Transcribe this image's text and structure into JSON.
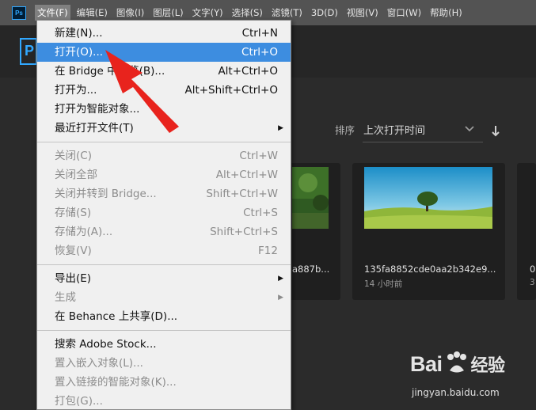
{
  "app": {
    "logo_text": "Ps",
    "home_logo_text": "P"
  },
  "menubar": {
    "items": [
      "文件(F)",
      "编辑(E)",
      "图像(I)",
      "图层(L)",
      "文字(Y)",
      "选择(S)",
      "滤镜(T)",
      "3D(D)",
      "视图(V)",
      "窗口(W)",
      "帮助(H)"
    ]
  },
  "file_menu": {
    "groups": [
      [
        {
          "label": "新建(N)...",
          "shortcut": "Ctrl+N",
          "disabled": false,
          "submenu": false,
          "highlighted": false
        },
        {
          "label": "打开(O)...",
          "shortcut": "Ctrl+O",
          "disabled": false,
          "submenu": false,
          "highlighted": true
        },
        {
          "label": "在 Bridge 中浏览(B)...",
          "shortcut": "Alt+Ctrl+O",
          "disabled": false,
          "submenu": false,
          "highlighted": false
        },
        {
          "label": "打开为...",
          "shortcut": "Alt+Shift+Ctrl+O",
          "disabled": false,
          "submenu": false,
          "highlighted": false
        },
        {
          "label": "打开为智能对象...",
          "shortcut": "",
          "disabled": false,
          "submenu": false,
          "highlighted": false
        },
        {
          "label": "最近打开文件(T)",
          "shortcut": "",
          "disabled": false,
          "submenu": true,
          "highlighted": false
        }
      ],
      [
        {
          "label": "关闭(C)",
          "shortcut": "Ctrl+W",
          "disabled": true,
          "submenu": false,
          "highlighted": false
        },
        {
          "label": "关闭全部",
          "shortcut": "Alt+Ctrl+W",
          "disabled": true,
          "submenu": false,
          "highlighted": false
        },
        {
          "label": "关闭并转到 Bridge...",
          "shortcut": "Shift+Ctrl+W",
          "disabled": true,
          "submenu": false,
          "highlighted": false
        },
        {
          "label": "存储(S)",
          "shortcut": "Ctrl+S",
          "disabled": true,
          "submenu": false,
          "highlighted": false
        },
        {
          "label": "存储为(A)...",
          "shortcut": "Shift+Ctrl+S",
          "disabled": true,
          "submenu": false,
          "highlighted": false
        },
        {
          "label": "恢复(V)",
          "shortcut": "F12",
          "disabled": true,
          "submenu": false,
          "highlighted": false
        }
      ],
      [
        {
          "label": "导出(E)",
          "shortcut": "",
          "disabled": false,
          "submenu": true,
          "highlighted": false
        },
        {
          "label": "生成",
          "shortcut": "",
          "disabled": true,
          "submenu": true,
          "highlighted": false
        },
        {
          "label": "在 Behance 上共享(D)...",
          "shortcut": "",
          "disabled": false,
          "submenu": false,
          "highlighted": false
        }
      ],
      [
        {
          "label": "搜索 Adobe Stock...",
          "shortcut": "",
          "disabled": false,
          "submenu": false,
          "highlighted": false
        },
        {
          "label": "置入嵌入对象(L)...",
          "shortcut": "",
          "disabled": true,
          "submenu": false,
          "highlighted": false
        },
        {
          "label": "置入链接的智能对象(K)...",
          "shortcut": "",
          "disabled": true,
          "submenu": false,
          "highlighted": false
        },
        {
          "label": "打包(G)...",
          "shortcut": "",
          "disabled": true,
          "submenu": false,
          "highlighted": false
        }
      ]
    ]
  },
  "home": {
    "sort_label": "排序",
    "sort_value": "上次打开时间",
    "recent_files": [
      {
        "name": "a887b...",
        "time": ""
      },
      {
        "name": "135fa8852cde0aa2b342e9...",
        "time": "14 小时前"
      },
      {
        "name": "0",
        "time": "3"
      }
    ]
  },
  "watermark": {
    "brand": "Bai",
    "brand_suffix": "经验",
    "url": "jingyan.baidu.com"
  },
  "colors": {
    "menubar": "#535353",
    "menu_bg": "#f0f0f0",
    "highlight": "#3d8de0",
    "annotation_arrow": "#e8231d",
    "ps_blue": "#31a8ff"
  }
}
